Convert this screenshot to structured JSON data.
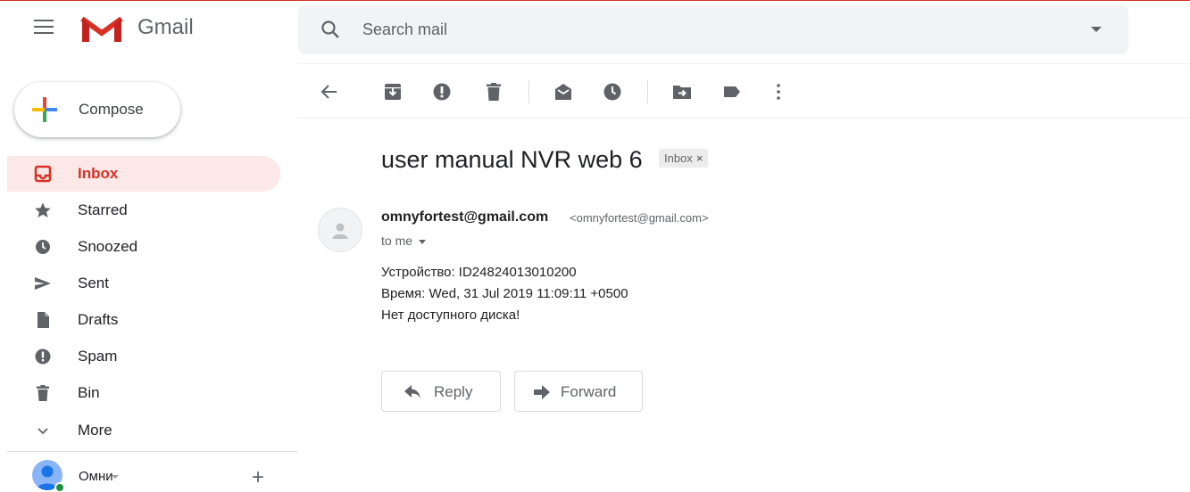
{
  "app": {
    "name": "Gmail",
    "brand_colors": {
      "red": "#d93025",
      "blue": "#4285f4",
      "green": "#34a853",
      "yellow": "#fbbc04"
    }
  },
  "search": {
    "placeholder": "Search mail"
  },
  "compose": {
    "label": "Compose"
  },
  "sidebar": {
    "items": [
      {
        "label": "Inbox",
        "icon": "inbox-icon",
        "active": true
      },
      {
        "label": "Starred",
        "icon": "star-icon"
      },
      {
        "label": "Snoozed",
        "icon": "clock-icon"
      },
      {
        "label": "Sent",
        "icon": "send-icon"
      },
      {
        "label": "Drafts",
        "icon": "file-icon"
      },
      {
        "label": "Spam",
        "icon": "report-icon"
      },
      {
        "label": "Bin",
        "icon": "trash-icon"
      },
      {
        "label": "More",
        "icon": "chevron-down-icon"
      }
    ]
  },
  "user": {
    "name": "Омни"
  },
  "toolbar": {
    "icons": [
      "back-arrow-icon",
      "archive-icon",
      "report-spam-icon",
      "delete-icon",
      "mark-unread-icon",
      "snooze-icon",
      "move-to-icon",
      "labels-icon",
      "more-vert-icon"
    ]
  },
  "message": {
    "subject": "user manual NVR web 6",
    "label_chip": "Inbox",
    "label_chip_close": "×",
    "sender_name": "omnyfortest@gmail.com",
    "sender_email": "<omnyfortest@gmail.com>",
    "to": "to me",
    "body": [
      "Устройство: ID24824013010200",
      "Время: Wed, 31 Jul 2019 11:09:11 +0500",
      "Нет доступного диска!"
    ]
  },
  "actions": {
    "reply": "Reply",
    "forward": "Forward"
  }
}
